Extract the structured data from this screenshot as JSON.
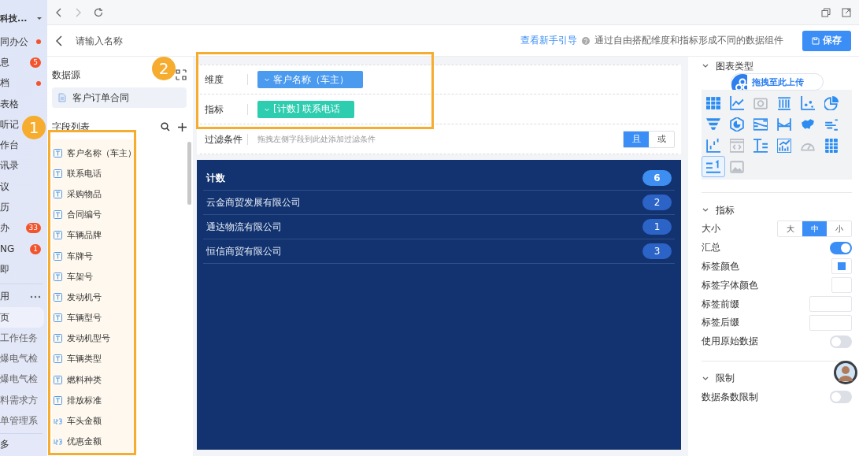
{
  "app_sidebar": {
    "title": "科技...",
    "items": [
      {
        "label": "同办公",
        "kind": "dot",
        "selected": false
      },
      {
        "label": "息",
        "kind": "count",
        "count": "5",
        "selected": false
      },
      {
        "label": "档",
        "kind": "dot",
        "selected": false
      },
      {
        "label": "表格",
        "kind": "plain",
        "selected": false
      },
      {
        "label": "听记",
        "kind": "plain",
        "selected": false
      },
      {
        "label": "作台",
        "kind": "plain",
        "selected": false
      },
      {
        "label": "讯录",
        "kind": "plain",
        "selected": false
      },
      {
        "label": "议",
        "kind": "plain",
        "selected": false
      },
      {
        "label": "历",
        "kind": "plain",
        "selected": false
      },
      {
        "label": "办",
        "kind": "count",
        "count": "33",
        "selected": false
      },
      {
        "label": "NG",
        "kind": "count",
        "count": "1",
        "selected": false
      },
      {
        "label": "即",
        "kind": "plain",
        "selected": false
      },
      {
        "label": "用",
        "kind": "section",
        "selected": false
      },
      {
        "label": "页",
        "kind": "plain",
        "selected": true
      },
      {
        "label": "工作任务",
        "kind": "plain",
        "selected": false
      },
      {
        "label": "爆电气检",
        "kind": "plain",
        "selected": false
      },
      {
        "label": "爆电气检",
        "kind": "plain",
        "selected": false
      },
      {
        "label": "料需求方",
        "kind": "plain",
        "selected": false
      },
      {
        "label": "单管理系",
        "kind": "plain",
        "selected": false
      },
      {
        "label": "多",
        "kind": "footer",
        "selected": false
      }
    ]
  },
  "header": {
    "name_placeholder": "请输入名称",
    "guide_link": "查看新手引导",
    "hint": "通过自由搭配维度和指标形成不同的数据组件",
    "save_button": "保存"
  },
  "data_source": {
    "heading": "数据源",
    "item": "客户订单合同"
  },
  "field_list": {
    "heading": "字段列表",
    "fields": [
      {
        "label": "客户名称（车主）",
        "kind": "text"
      },
      {
        "label": "联系电话",
        "kind": "text"
      },
      {
        "label": "采购物品",
        "kind": "text"
      },
      {
        "label": "合同编号",
        "kind": "text"
      },
      {
        "label": "车辆品牌",
        "kind": "text"
      },
      {
        "label": "车牌号",
        "kind": "text"
      },
      {
        "label": "车架号",
        "kind": "text"
      },
      {
        "label": "发动机号",
        "kind": "text"
      },
      {
        "label": "车辆型号",
        "kind": "text"
      },
      {
        "label": "发动机型号",
        "kind": "text"
      },
      {
        "label": "车辆类型",
        "kind": "text"
      },
      {
        "label": "燃料种类",
        "kind": "text"
      },
      {
        "label": "排放标准",
        "kind": "text"
      },
      {
        "label": "车头金额",
        "kind": "number"
      },
      {
        "label": "优惠金额",
        "kind": "number"
      }
    ]
  },
  "config": {
    "rows": [
      {
        "label": "维度",
        "kind": "tag",
        "tag": "客户名称（车主）",
        "color": "#4a9af0"
      },
      {
        "label": "指标",
        "kind": "tag",
        "tag": "[计数] 联系电话",
        "color": "#2ecdb0"
      },
      {
        "label": "过滤条件",
        "kind": "filter",
        "placeholder": "拖拽左侧字段到此处添加过滤条件",
        "options": [
          {
            "label": "且",
            "selected": true
          },
          {
            "label": "或",
            "selected": false
          }
        ]
      }
    ]
  },
  "chart": {
    "header": "计数",
    "total": "6",
    "rows": [
      {
        "name": "云金商贸发展有限公司",
        "count": "2"
      },
      {
        "name": "通达物流有限公司",
        "count": "1"
      },
      {
        "name": "恒信商贸有限公司",
        "count": "3"
      }
    ]
  },
  "chart_types": {
    "heading": "图表类型",
    "expanded": true,
    "types": [
      {
        "kind": "table",
        "disabled": false,
        "selected": false
      },
      {
        "kind": "line",
        "disabled": false,
        "selected": false
      },
      {
        "kind": "camera",
        "disabled": true,
        "selected": false
      },
      {
        "kind": "bar",
        "disabled": false,
        "selected": false
      },
      {
        "kind": "scatter",
        "disabled": false,
        "selected": false
      },
      {
        "kind": "pie",
        "disabled": false,
        "selected": false
      },
      {
        "kind": "funnel",
        "disabled": false,
        "selected": false
      },
      {
        "kind": "hexagon",
        "disabled": false,
        "selected": false
      },
      {
        "kind": "sankey",
        "disabled": false,
        "selected": false
      },
      {
        "kind": "bullet",
        "disabled": false,
        "selected": false
      },
      {
        "kind": "map",
        "disabled": false,
        "selected": false
      },
      {
        "kind": "cloud",
        "disabled": false,
        "selected": false
      },
      {
        "kind": "step",
        "disabled": false,
        "selected": false
      },
      {
        "kind": "code",
        "disabled": true,
        "selected": false
      },
      {
        "kind": "text",
        "disabled": false,
        "selected": false
      },
      {
        "kind": "trend",
        "disabled": false,
        "selected": false
      },
      {
        "kind": "gauge",
        "disabled": true,
        "selected": false
      },
      {
        "kind": "grid",
        "disabled": false,
        "selected": false
      },
      {
        "kind": "rank",
        "disabled": false,
        "selected": true
      },
      {
        "kind": "image",
        "disabled": true,
        "selected": false
      }
    ]
  },
  "upload_pill": "拖拽至此上传",
  "indicator": {
    "heading": "指标",
    "expanded": true,
    "size": {
      "label": "大小",
      "options": [
        {
          "label": "大",
          "selected": false
        },
        {
          "label": "中",
          "selected": true
        },
        {
          "label": "小",
          "selected": false
        }
      ]
    },
    "settings": [
      {
        "label": "汇总",
        "kind": "switch",
        "on": true
      },
      {
        "label": "标签颜色",
        "kind": "color",
        "color": "#3a8ef6"
      },
      {
        "label": "标签字体颜色",
        "kind": "color",
        "color": "#ffffff"
      },
      {
        "label": "标签前缀",
        "kind": "input"
      },
      {
        "label": "标签后缀",
        "kind": "input"
      },
      {
        "label": "使用原始数据",
        "kind": "switch",
        "on": false
      }
    ]
  },
  "limit": {
    "heading": "限制",
    "expanded": true,
    "settings": [
      {
        "label": "数据条数限制",
        "kind": "switch",
        "on": false
      }
    ]
  },
  "annotations": [
    {
      "number": "1"
    },
    {
      "number": "2"
    }
  ]
}
